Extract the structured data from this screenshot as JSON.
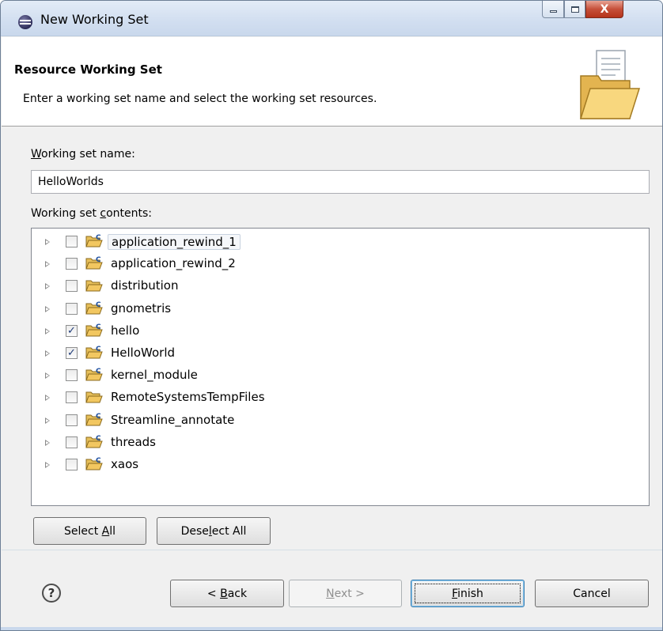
{
  "window": {
    "title": "New Working Set",
    "buttons": {
      "minimize_icon": "minimize-icon",
      "maximize_icon": "maximize-icon",
      "close_icon": "close-icon",
      "close_glyph": "X"
    }
  },
  "banner": {
    "title": "Resource Working Set",
    "description": "Enter a working set name and select the working set resources.",
    "icon": "working-set-folder-icon"
  },
  "name_field": {
    "label_accel": "W",
    "label_rest": "orking set name:",
    "value": "HelloWorlds"
  },
  "contents": {
    "label_pre": "Working set ",
    "label_accel": "c",
    "label_post": "ontents:",
    "items": [
      {
        "name": "application_rewind_1",
        "checked": false,
        "icon": "c-project-folder-icon"
      },
      {
        "name": "application_rewind_2",
        "checked": false,
        "icon": "c-project-folder-icon"
      },
      {
        "name": "distribution",
        "checked": false,
        "icon": "folder-icon"
      },
      {
        "name": "gnometris",
        "checked": false,
        "icon": "c-project-folder-icon"
      },
      {
        "name": "hello",
        "checked": true,
        "icon": "c-project-folder-icon"
      },
      {
        "name": "HelloWorld",
        "checked": true,
        "icon": "c-project-folder-icon"
      },
      {
        "name": "kernel_module",
        "checked": false,
        "icon": "c-project-folder-icon"
      },
      {
        "name": "RemoteSystemsTempFiles",
        "checked": false,
        "icon": "folder-icon"
      },
      {
        "name": "Streamline_annotate",
        "checked": false,
        "icon": "c-project-folder-icon"
      },
      {
        "name": "threads",
        "checked": false,
        "icon": "c-project-folder-icon"
      },
      {
        "name": "xaos",
        "checked": false,
        "icon": "c-project-folder-icon"
      }
    ],
    "check_glyph": "✓"
  },
  "selection_buttons": {
    "select_all_pre": "Select ",
    "select_all_accel": "A",
    "select_all_post": "ll",
    "deselect_all_pre": "Dese",
    "deselect_all_accel": "l",
    "deselect_all_post": "ect All"
  },
  "footer": {
    "help_glyph": "?",
    "back_pre": "< ",
    "back_accel": "B",
    "back_post": "ack",
    "next_accel": "N",
    "next_post": "ext >",
    "finish_accel": "F",
    "finish_post": "inish",
    "cancel": "Cancel"
  },
  "colors": {
    "title_bar": "#d1def0",
    "close_button": "#c6503a",
    "checkmark": "#1d3a78",
    "folder": "#f2c760"
  }
}
